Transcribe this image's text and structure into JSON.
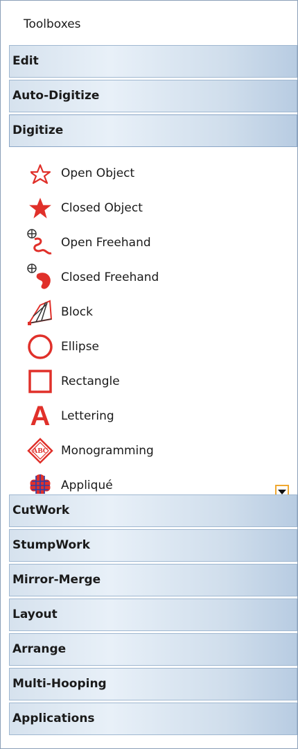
{
  "toolboxes": {
    "title": "Toolboxes"
  },
  "sections_top": [
    {
      "label": "Edit"
    },
    {
      "label": "Auto-Digitize"
    },
    {
      "label": "Digitize"
    }
  ],
  "digitize": {
    "tools": [
      {
        "label": "Open Object",
        "icon": "open-object-icon"
      },
      {
        "label": "Closed Object",
        "icon": "closed-object-icon"
      },
      {
        "label": "Open Freehand",
        "icon": "open-freehand-icon"
      },
      {
        "label": "Closed Freehand",
        "icon": "closed-freehand-icon"
      },
      {
        "label": "Block",
        "icon": "block-icon"
      },
      {
        "label": "Ellipse",
        "icon": "ellipse-icon"
      },
      {
        "label": "Rectangle",
        "icon": "rectangle-icon"
      },
      {
        "label": "Lettering",
        "icon": "lettering-icon"
      },
      {
        "label": "Monogramming",
        "icon": "monogramming-icon"
      },
      {
        "label": "Appliqué",
        "icon": "applique-icon"
      }
    ],
    "lettering_glyph": "A",
    "monogram_text": "ABC"
  },
  "sections_bottom": [
    {
      "label": "CutWork"
    },
    {
      "label": "StumpWork"
    },
    {
      "label": "Mirror-Merge"
    },
    {
      "label": "Layout"
    },
    {
      "label": "Arrange"
    },
    {
      "label": "Multi-Hooping"
    },
    {
      "label": "Applications"
    }
  ],
  "colors": {
    "icon_red": "#e0302a",
    "accent_orange": "#f0a830"
  }
}
